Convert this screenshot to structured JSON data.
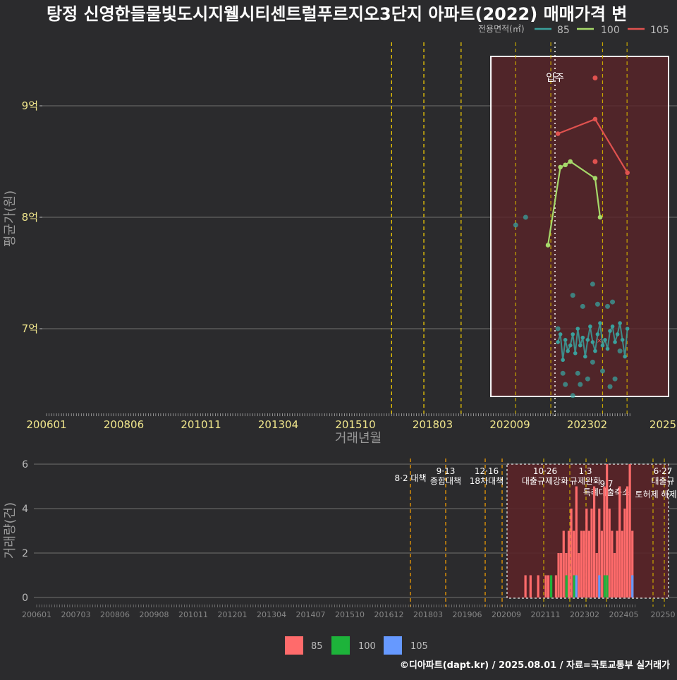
{
  "title": "탕정 신영한들물빛도시지웰시티센트럴푸르지오3단지 아파트(2022) 매매가격 변",
  "footer": "©디아파트(dapt.kr) / 2025.08.01 / 자료=국토교통부 실거래가",
  "colors": {
    "background": "#2b2b2d",
    "s85": "#3aa09c",
    "s100": "#a6d96a",
    "s105": "#e0524f",
    "bar85": "#ff6b6b",
    "bar100": "#1db33a",
    "bar105": "#6699ff",
    "policy_line": "#ffd700",
    "policy_line_bottom": "#ffa500",
    "highlight_fill": "#5a2428"
  },
  "chart_data": [
    {
      "type": "line",
      "title": "탕정 신영한들물빛도시지웰시티센트럴푸르지오3단지 아파트(2022) 매매가격 변",
      "xlabel": "거래년월",
      "ylabel": "평균가(원)",
      "x_tick_labels": [
        "200601",
        "200806",
        "201011",
        "201304",
        "201510",
        "201803",
        "202009",
        "202302",
        "2025"
      ],
      "y_tick_labels": [
        "7억",
        "8억",
        "9억"
      ],
      "ylim": [
        6.35,
        9.5
      ],
      "legend_title": "전용면적(㎡)",
      "legend_position": "top-right",
      "annotation": "입주",
      "series": [
        {
          "name": "85",
          "x": [
            "2023-03",
            "2023-04",
            "2023-05",
            "2023-06",
            "2023-07",
            "2023-08",
            "2023-09",
            "2023-10",
            "2023-11",
            "2023-12",
            "2024-01",
            "2024-02",
            "2024-03",
            "2024-04",
            "2024-05",
            "2024-06",
            "2024-07",
            "2024-08",
            "2024-09",
            "2024-10",
            "2024-11",
            "2024-12",
            "2025-01",
            "2025-02",
            "2025-03",
            "2025-04",
            "2025-05",
            "2025-06",
            "2025-07"
          ],
          "values": [
            6.88,
            6.95,
            6.72,
            6.9,
            6.8,
            6.85,
            6.95,
            6.78,
            7.0,
            6.85,
            6.92,
            6.75,
            6.9,
            7.02,
            6.88,
            6.8,
            6.95,
            7.05,
            6.85,
            6.9,
            6.82,
            6.98,
            7.02,
            6.88,
            6.95,
            7.05,
            6.9,
            6.75,
            7.0
          ]
        },
        {
          "name": "100",
          "x": [
            "2022-11",
            "2023-04",
            "2023-06",
            "2023-08",
            "2024-06",
            "2024-08"
          ],
          "values": [
            7.75,
            8.45,
            8.47,
            8.5,
            8.35,
            8.0
          ]
        },
        {
          "name": "105",
          "x": [
            "2023-03",
            "2024-06",
            "2025-07"
          ],
          "values": [
            8.75,
            8.88,
            8.4
          ]
        }
      ],
      "points_85": [
        {
          "x": "2021-10",
          "y": 7.93
        },
        {
          "x": "2022-02",
          "y": 8.0
        },
        {
          "x": "2023-03",
          "y": 7.0
        },
        {
          "x": "2023-05",
          "y": 6.6
        },
        {
          "x": "2023-06",
          "y": 6.5
        },
        {
          "x": "2023-09",
          "y": 7.3
        },
        {
          "x": "2023-09",
          "y": 6.4
        },
        {
          "x": "2023-11",
          "y": 6.6
        },
        {
          "x": "2023-12",
          "y": 6.5
        },
        {
          "x": "2024-01",
          "y": 7.2
        },
        {
          "x": "2024-03",
          "y": 6.55
        },
        {
          "x": "2024-05",
          "y": 7.4
        },
        {
          "x": "2024-05",
          "y": 6.7
        },
        {
          "x": "2024-07",
          "y": 7.22
        },
        {
          "x": "2024-09",
          "y": 6.62
        },
        {
          "x": "2024-11",
          "y": 7.2
        },
        {
          "x": "2024-12",
          "y": 6.48
        },
        {
          "x": "2025-01",
          "y": 7.24
        },
        {
          "x": "2025-02",
          "y": 6.55
        },
        {
          "x": "2025-04",
          "y": 6.8
        }
      ],
      "points_100": [],
      "points_105": [
        {
          "x": "2024-06",
          "y": 9.25
        },
        {
          "x": "2024-06",
          "y": 8.5
        }
      ]
    },
    {
      "type": "bar",
      "ylabel": "거래량(건)",
      "ylim": [
        0,
        6
      ],
      "y_tick_labels": [
        "0",
        "2",
        "4",
        "6"
      ],
      "x_tick_labels": [
        "200601",
        "200703",
        "200806",
        "200908",
        "201011",
        "201201",
        "201304",
        "201407",
        "201510",
        "201612",
        "201803",
        "201906",
        "202009",
        "202111",
        "202302",
        "202405",
        "20250"
      ],
      "legend_position": "bottom",
      "legend": [
        "85",
        "100",
        "105"
      ],
      "policy_labels": [
        {
          "date": "8·2 대책",
          "desc": ""
        },
        {
          "date": "9·13",
          "desc": "종합대책"
        },
        {
          "date": "12·16",
          "desc": "18차대책"
        },
        {
          "date": "10·26",
          "desc": "대출규제강화"
        },
        {
          "date": "1·3",
          "desc": "규제완화"
        },
        {
          "date": "9·7",
          "desc": "특례대출축소"
        },
        {
          "date": "",
          "desc": "토허제 해제"
        },
        {
          "date": "6·27",
          "desc": "대출규"
        }
      ],
      "series": [
        {
          "name": "85",
          "months": [
            "2022-01",
            "2022-03",
            "2022-06",
            "2022-09",
            "2022-10",
            "2023-01",
            "2023-02",
            "2023-03",
            "2023-04",
            "2023-05",
            "2023-06",
            "2023-07",
            "2023-08",
            "2023-09",
            "2023-10",
            "2023-11",
            "2023-12",
            "2024-01",
            "2024-02",
            "2024-03",
            "2024-04",
            "2024-05",
            "2024-06",
            "2024-07",
            "2024-08",
            "2024-09",
            "2024-10",
            "2024-11",
            "2024-12",
            "2025-01",
            "2025-02",
            "2025-03",
            "2025-04",
            "2025-05",
            "2025-06",
            "2025-07"
          ],
          "values": [
            1,
            1,
            1,
            1,
            1,
            1,
            2,
            2,
            3,
            2,
            3,
            4,
            3,
            5,
            2,
            3,
            3,
            4,
            3,
            4,
            5,
            2,
            4,
            3,
            5,
            6,
            4,
            3,
            2,
            3,
            5,
            3,
            4,
            5,
            6,
            3
          ]
        },
        {
          "name": "100",
          "months": [
            "2022-11",
            "2023-05",
            "2023-08",
            "2024-08",
            "2024-09"
          ],
          "values": [
            1,
            1,
            1,
            1,
            1
          ]
        },
        {
          "name": "105",
          "months": [
            "2023-09",
            "2024-06",
            "2025-07"
          ],
          "values": [
            1,
            1,
            1
          ]
        }
      ]
    }
  ]
}
